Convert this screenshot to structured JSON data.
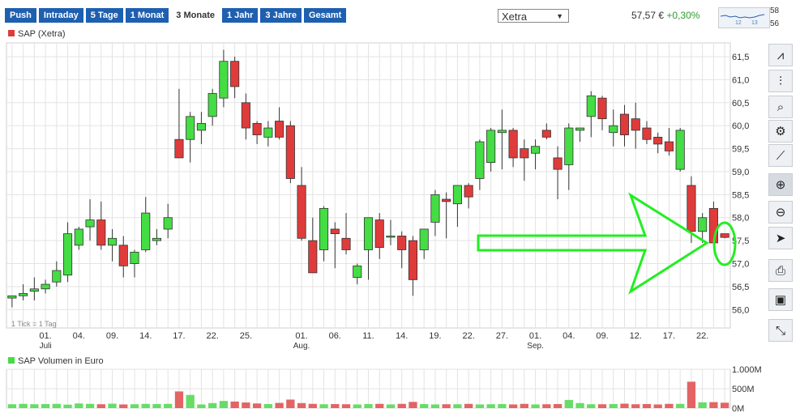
{
  "tabs": [
    {
      "label": "Push",
      "active": false
    },
    {
      "label": "Intraday",
      "active": false
    },
    {
      "label": "5 Tage",
      "active": false
    },
    {
      "label": "1 Monat",
      "active": false
    },
    {
      "label": "3 Monate",
      "active": true
    },
    {
      "label": "1 Jahr",
      "active": false
    },
    {
      "label": "3 Jahre",
      "active": false
    },
    {
      "label": "Gesamt",
      "active": false
    }
  ],
  "exchange": {
    "selected": "Xetra"
  },
  "quote": {
    "price": "57,57 €",
    "change": "+0,30%"
  },
  "sparkline": {
    "high_label": "58",
    "low_label": "56",
    "tick_a": "12",
    "tick_b": "13"
  },
  "toolbar": [
    {
      "icon": "line-chart-icon",
      "glyph": "⩘"
    },
    {
      "icon": "ohlc-chart-icon",
      "glyph": "⫶"
    },
    {
      "icon": "indicator-search-icon",
      "glyph": "⌕"
    },
    {
      "icon": "settings-icon",
      "glyph": "⚙"
    },
    {
      "icon": "draw-line-icon",
      "glyph": "⟋"
    },
    {
      "icon": "zoom-in-icon",
      "glyph": "⊕"
    },
    {
      "icon": "zoom-out-icon",
      "glyph": "⊖"
    },
    {
      "icon": "cursor-icon",
      "glyph": "➤"
    },
    {
      "icon": "print-icon",
      "glyph": "⎙"
    },
    {
      "icon": "save-icon",
      "glyph": "▣"
    },
    {
      "icon": "collapse-icon",
      "glyph": "⤡"
    }
  ],
  "colors": {
    "up": "#44dd44",
    "down": "#e03b3b",
    "grid": "#e3e3e3",
    "annotation": "#22ee22",
    "vol_up": "#66dd66",
    "vol_down": "#e36464"
  },
  "chart_data": [
    {
      "type": "candlestick",
      "legend": "SAP (Xetra)",
      "note": "1 Tick = 1 Tag",
      "ylim": [
        55.6,
        61.8
      ],
      "y_ticks": [
        "56,0",
        "56,5",
        "57,0",
        "57,5",
        "58,0",
        "58,5",
        "59,0",
        "59,5",
        "60,0",
        "60,5",
        "61,0",
        "61,5"
      ],
      "x_ticks": [
        {
          "label": "01.",
          "i": 3,
          "sub": "Juli"
        },
        {
          "label": "04.",
          "i": 6
        },
        {
          "label": "09.",
          "i": 9
        },
        {
          "label": "14.",
          "i": 12
        },
        {
          "label": "17.",
          "i": 15
        },
        {
          "label": "22.",
          "i": 18
        },
        {
          "label": "25.",
          "i": 21
        },
        {
          "label": "01.",
          "i": 26,
          "sub": "Aug."
        },
        {
          "label": "06.",
          "i": 29
        },
        {
          "label": "11.",
          "i": 32
        },
        {
          "label": "14.",
          "i": 35
        },
        {
          "label": "19.",
          "i": 38
        },
        {
          "label": "22.",
          "i": 41
        },
        {
          "label": "27.",
          "i": 44
        },
        {
          "label": "01.",
          "i": 47,
          "sub": "Sep."
        },
        {
          "label": "04.",
          "i": 50
        },
        {
          "label": "09.",
          "i": 53
        },
        {
          "label": "12.",
          "i": 56
        },
        {
          "label": "17.",
          "i": 59
        },
        {
          "label": "22.",
          "i": 62
        }
      ],
      "ohlc": [
        [
          56.25,
          56.3,
          56.05,
          56.3
        ],
        [
          56.3,
          56.55,
          56.2,
          56.35
        ],
        [
          56.4,
          56.7,
          56.2,
          56.45
        ],
        [
          56.45,
          56.65,
          56.35,
          56.55
        ],
        [
          56.6,
          57.05,
          56.5,
          56.85
        ],
        [
          56.75,
          57.9,
          56.6,
          57.65
        ],
        [
          57.4,
          57.8,
          57.3,
          57.75
        ],
        [
          57.8,
          58.4,
          57.5,
          57.95
        ],
        [
          57.95,
          58.35,
          57.3,
          57.4
        ],
        [
          57.4,
          57.75,
          57.05,
          57.55
        ],
        [
          57.4,
          57.6,
          56.7,
          56.95
        ],
        [
          57.0,
          57.3,
          56.7,
          57.25
        ],
        [
          57.3,
          58.45,
          57.25,
          58.1
        ],
        [
          57.5,
          57.75,
          57.4,
          57.55
        ],
        [
          57.75,
          58.3,
          57.55,
          58.0
        ],
        [
          59.7,
          60.8,
          59.3,
          59.3
        ],
        [
          59.7,
          60.3,
          59.2,
          60.2
        ],
        [
          59.9,
          60.3,
          59.6,
          60.05
        ],
        [
          60.2,
          60.8,
          60.0,
          60.7
        ],
        [
          60.6,
          61.65,
          60.4,
          61.4
        ],
        [
          61.4,
          61.5,
          60.6,
          60.85
        ],
        [
          60.5,
          60.7,
          59.7,
          59.95
        ],
        [
          60.05,
          60.1,
          59.6,
          59.8
        ],
        [
          59.75,
          60.1,
          59.55,
          59.95
        ],
        [
          60.1,
          60.4,
          59.7,
          59.75
        ],
        [
          60.0,
          60.1,
          58.75,
          58.85
        ],
        [
          58.7,
          59.1,
          57.5,
          57.55
        ],
        [
          57.5,
          58.0,
          56.85,
          56.8
        ],
        [
          57.3,
          58.25,
          57.05,
          58.2
        ],
        [
          57.75,
          57.9,
          56.9,
          57.65
        ],
        [
          57.55,
          58.1,
          57.2,
          57.3
        ],
        [
          56.7,
          57.0,
          56.55,
          56.95
        ],
        [
          57.3,
          58.0,
          56.65,
          58.0
        ],
        [
          57.95,
          58.1,
          57.1,
          57.35
        ],
        [
          57.6,
          57.95,
          57.4,
          57.6
        ],
        [
          57.6,
          57.7,
          56.9,
          57.3
        ],
        [
          57.5,
          57.6,
          56.3,
          56.65
        ],
        [
          57.3,
          57.75,
          57.1,
          57.75
        ],
        [
          57.9,
          58.6,
          57.6,
          58.5
        ],
        [
          58.4,
          58.55,
          57.55,
          58.35
        ],
        [
          58.3,
          58.7,
          57.8,
          58.7
        ],
        [
          58.7,
          58.75,
          58.2,
          58.45
        ],
        [
          58.85,
          59.7,
          58.6,
          59.65
        ],
        [
          59.2,
          59.95,
          59.0,
          59.9
        ],
        [
          59.85,
          60.35,
          59.05,
          59.9
        ],
        [
          59.9,
          59.95,
          59.1,
          59.3
        ],
        [
          59.5,
          59.7,
          58.8,
          59.3
        ],
        [
          59.4,
          59.7,
          59.05,
          59.55
        ],
        [
          59.9,
          60.05,
          59.7,
          59.75
        ],
        [
          59.3,
          59.55,
          58.4,
          59.05
        ],
        [
          59.15,
          60.05,
          58.6,
          59.95
        ],
        [
          59.9,
          59.95,
          59.65,
          59.95
        ],
        [
          60.2,
          60.75,
          59.75,
          60.65
        ],
        [
          60.6,
          60.65,
          59.9,
          60.15
        ],
        [
          59.85,
          60.35,
          59.55,
          60.0
        ],
        [
          60.25,
          60.45,
          59.55,
          59.8
        ],
        [
          60.15,
          60.5,
          59.5,
          59.9
        ],
        [
          59.95,
          60.1,
          59.6,
          59.7
        ],
        [
          59.75,
          59.85,
          59.4,
          59.6
        ],
        [
          59.65,
          59.95,
          59.35,
          59.45
        ],
        [
          59.05,
          59.95,
          59.0,
          59.9
        ],
        [
          58.7,
          58.9,
          57.45,
          57.7
        ],
        [
          57.7,
          58.1,
          57.45,
          58.0
        ],
        [
          58.2,
          58.35,
          57.4,
          57.45
        ],
        [
          57.65,
          57.65,
          57.55,
          57.57
        ]
      ],
      "annotation": "arrow and ellipse pointing at last candle"
    },
    {
      "type": "bar",
      "legend": "SAP Volumen in Euro",
      "y_ticks": [
        "0M",
        "500M",
        "1.000M"
      ],
      "ylim": [
        0,
        1000
      ],
      "volume": [
        100,
        110,
        100,
        105,
        110,
        90,
        120,
        110,
        100,
        115,
        95,
        100,
        110,
        105,
        110,
        430,
        340,
        95,
        130,
        185,
        170,
        145,
        120,
        105,
        135,
        220,
        130,
        110,
        100,
        105,
        100,
        95,
        105,
        110,
        95,
        110,
        160,
        105,
        95,
        100,
        100,
        110,
        95,
        100,
        105,
        95,
        110,
        95,
        100,
        105,
        210,
        130,
        100,
        100,
        105,
        115,
        100,
        105,
        95,
        110,
        110,
        680,
        150,
        155,
        140
      ]
    }
  ]
}
